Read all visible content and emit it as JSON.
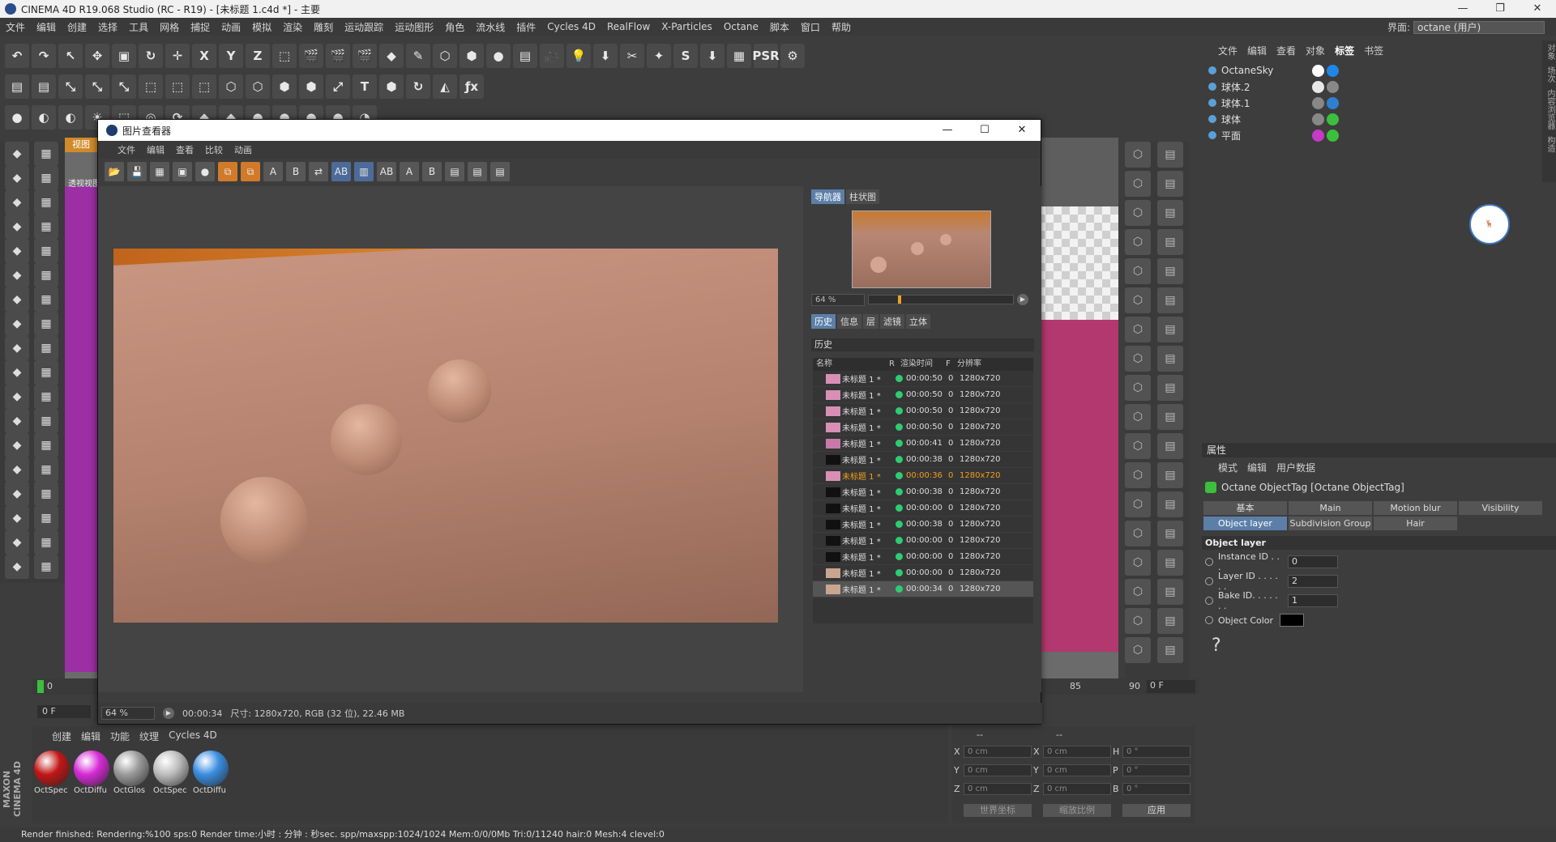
{
  "app": {
    "title": "CINEMA 4D R19.068 Studio (RC - R19) - [未标题 1.c4d *] - 主要",
    "window_buttons": [
      "—",
      "❐",
      "✕"
    ],
    "layout_label": "界面:",
    "layout_value": "octane (用户)"
  },
  "menu": [
    "文件",
    "编辑",
    "创建",
    "选择",
    "工具",
    "网格",
    "捕捉",
    "动画",
    "模拟",
    "渲染",
    "雕刻",
    "运动跟踪",
    "运动图形",
    "角色",
    "流水线",
    "插件",
    "Cycles 4D",
    "RealFlow",
    "X-Particles",
    "Octane",
    "脚本",
    "窗口",
    "帮助"
  ],
  "toolbar_row1": [
    "↶",
    "↷",
    "↖",
    "✥",
    "▣",
    "↻",
    "✛",
    "X",
    "Y",
    "Z",
    "⬚",
    "🎬",
    "🎬",
    "🎬",
    "◆",
    "✎",
    "⬡",
    "⬢",
    "●",
    "▤",
    "🎥",
    "💡",
    "⬇",
    "✂",
    "✦",
    "S",
    "⬇",
    "▦",
    "PSR",
    "⚙"
  ],
  "toolbar_row2": [
    "▤",
    "▤",
    "⤡",
    "⤡",
    "⤡",
    "⬚",
    "⬚",
    "⬚",
    "⬡",
    "⬡",
    "⬢",
    "⬢",
    "⤢",
    "T",
    "⬢",
    "↻",
    "◭",
    "ƒx"
  ],
  "toolbar_row3": [
    "●",
    "◐",
    "◐",
    "☀",
    "⬚",
    "◎",
    "⟳",
    "◆",
    "◆",
    "●",
    "●",
    "●",
    "●",
    "◔"
  ],
  "picture_viewer": {
    "title": "图片查看器",
    "menu": [
      "文件",
      "编辑",
      "查看",
      "比较",
      "动画"
    ],
    "nav_tabs": [
      "导航器",
      "柱状图"
    ],
    "zoom": "64 %",
    "info_tabs": [
      "历史",
      "信息",
      "层",
      "滤镜",
      "立体"
    ],
    "history_title": "历史",
    "history_columns": [
      "名称",
      "R",
      "渲染时间",
      "F",
      "分辨率"
    ],
    "history": [
      {
        "name": "未标题 1 *",
        "time": "00:00:50",
        "f": "0",
        "res": "1280x720",
        "thumb": "#d78fb5"
      },
      {
        "name": "未标题 1 *",
        "time": "00:00:50",
        "f": "0",
        "res": "1280x720",
        "thumb": "#d78fb5"
      },
      {
        "name": "未标题 1 *",
        "time": "00:00:50",
        "f": "0",
        "res": "1280x720",
        "thumb": "#d78fb5"
      },
      {
        "name": "未标题 1 *",
        "time": "00:00:50",
        "f": "0",
        "res": "1280x720",
        "thumb": "#d78fb5"
      },
      {
        "name": "未标题 1 *",
        "time": "00:00:41",
        "f": "0",
        "res": "1280x720",
        "thumb": "#c77aa8"
      },
      {
        "name": "未标题 1 *",
        "time": "00:00:38",
        "f": "0",
        "res": "1280x720",
        "thumb": "#111111"
      },
      {
        "name": "未标题 1 *",
        "time": "00:00:36",
        "f": "0",
        "res": "1280x720",
        "thumb": "#d78fb5"
      },
      {
        "name": "未标题 1 *",
        "time": "00:00:38",
        "f": "0",
        "res": "1280x720",
        "thumb": "#111111"
      },
      {
        "name": "未标题 1 *",
        "time": "00:00:00",
        "f": "0",
        "res": "1280x720",
        "thumb": "#111111"
      },
      {
        "name": "未标题 1 *",
        "time": "00:00:38",
        "f": "0",
        "res": "1280x720",
        "thumb": "#111111"
      },
      {
        "name": "未标题 1 *",
        "time": "00:00:00",
        "f": "0",
        "res": "1280x720",
        "thumb": "#111111"
      },
      {
        "name": "未标题 1 *",
        "time": "00:00:00",
        "f": "0",
        "res": "1280x720",
        "thumb": "#111111"
      },
      {
        "name": "未标题 1 *",
        "time": "00:00:00",
        "f": "0",
        "res": "1280x720",
        "thumb": "#c9a48e"
      },
      {
        "name": "未标题 1 *",
        "time": "00:00:34",
        "f": "0",
        "res": "1280x720",
        "thumb": "#c9a48e"
      }
    ],
    "current_history_index": 6,
    "status_zoom": "64 %",
    "status_time": "00:00:34",
    "status_info": "尺寸: 1280x720, RGB (32 位), 22.46 MB"
  },
  "objects_panel": {
    "menu": [
      "文件",
      "编辑",
      "查看",
      "对象",
      "标签",
      "书签"
    ],
    "active_menu": "标签",
    "objects": [
      {
        "name": "OctaneSky"
      },
      {
        "name": "球体.2"
      },
      {
        "name": "球体.1"
      },
      {
        "name": "球体"
      },
      {
        "name": "平面"
      }
    ]
  },
  "side_tabs": [
    "对象",
    "场次",
    "内容浏览器",
    "构造"
  ],
  "attributes": {
    "header": "属性",
    "menu": [
      "模式",
      "编辑",
      "用户数据"
    ],
    "tag_title": "Octane ObjectTag [Octane ObjectTag]",
    "tabs_row1": [
      "基本",
      "Main",
      "Motion blur",
      "Visibility"
    ],
    "tabs_row2": [
      "Object layer",
      "Subdivision Group",
      "Hair"
    ],
    "section": "Object layer",
    "fields": [
      {
        "label": "Instance ID . . .",
        "value": "0"
      },
      {
        "label": "Layer ID . . . . . .",
        "value": "2"
      },
      {
        "label": "Bake ID. . . . . . .",
        "value": "1"
      }
    ],
    "color_label": "Object Color",
    "help": "?"
  },
  "viewport": {
    "tabs": [
      "视图"
    ],
    "menu_stub": "查看",
    "label": "透视视图"
  },
  "timeline": {
    "start": "0",
    "end": "90",
    "mark": "85",
    "frame_left": "0 F",
    "frame_right": "0 F"
  },
  "materials": {
    "menu": [
      "创建",
      "编辑",
      "功能",
      "纹理",
      "Cycles 4D"
    ],
    "items": [
      {
        "name": "OctSpec",
        "color": "#c21616"
      },
      {
        "name": "OctDiffu",
        "color": "#d62ad6"
      },
      {
        "name": "OctGlos",
        "color": "#9a9a9a"
      },
      {
        "name": "OctSpec",
        "color": "#bdbdbd"
      },
      {
        "name": "OctDiffu",
        "color": "#3b8de0"
      }
    ]
  },
  "coords": {
    "header": "--",
    "rows": [
      {
        "a": "X",
        "av": "0 cm",
        "b": "X",
        "bv": "0 cm",
        "c": "H",
        "cv": "0 °"
      },
      {
        "a": "Y",
        "av": "0 cm",
        "b": "Y",
        "bv": "0 cm",
        "c": "P",
        "cv": "0 °"
      },
      {
        "a": "Z",
        "av": "0 cm",
        "b": "Z",
        "bv": "0 cm",
        "c": "B",
        "cv": "0 °"
      }
    ],
    "world": "世界坐标",
    "scale": "缩放比例",
    "apply": "应用"
  },
  "status": "Render finished: Rendering:%100 sps:0 Render time:小时 : 分钟 : 秒sec. spp/maxspp:1024/1024 Mem:0/0/0Mb Tri:0/11240 hair:0 Mesh:4 clevel:0",
  "maxon": "MAXON CINEMA 4D"
}
